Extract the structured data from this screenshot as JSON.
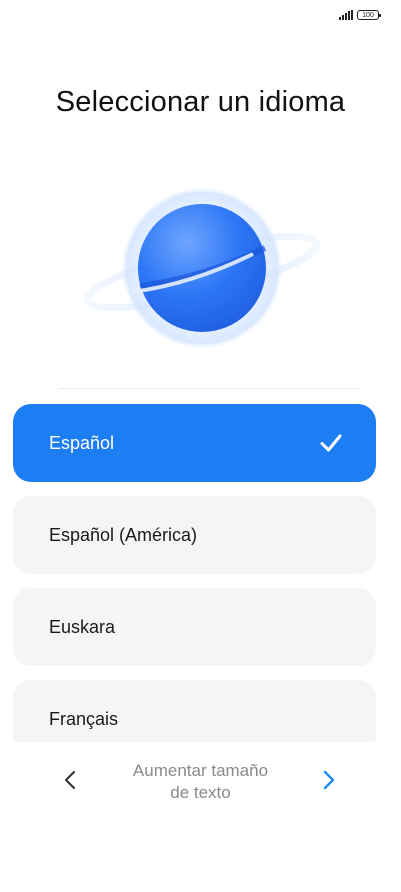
{
  "status_bar": {
    "battery": "100"
  },
  "title": "Seleccionar un idioma",
  "languages": [
    {
      "label": "Español",
      "selected": true
    },
    {
      "label": "Español (América)",
      "selected": false
    },
    {
      "label": "Euskara",
      "selected": false
    },
    {
      "label": "Français",
      "selected": false
    }
  ],
  "bottom_nav": {
    "label_line1": "Aumentar tamaño",
    "label_line2": "de texto",
    "prev_icon": "chevron-left-icon",
    "next_icon": "chevron-right-icon"
  },
  "colors": {
    "accent": "#1d7df2",
    "item_bg": "#f5f5f5",
    "next_arrow": "#1d8ff2"
  }
}
